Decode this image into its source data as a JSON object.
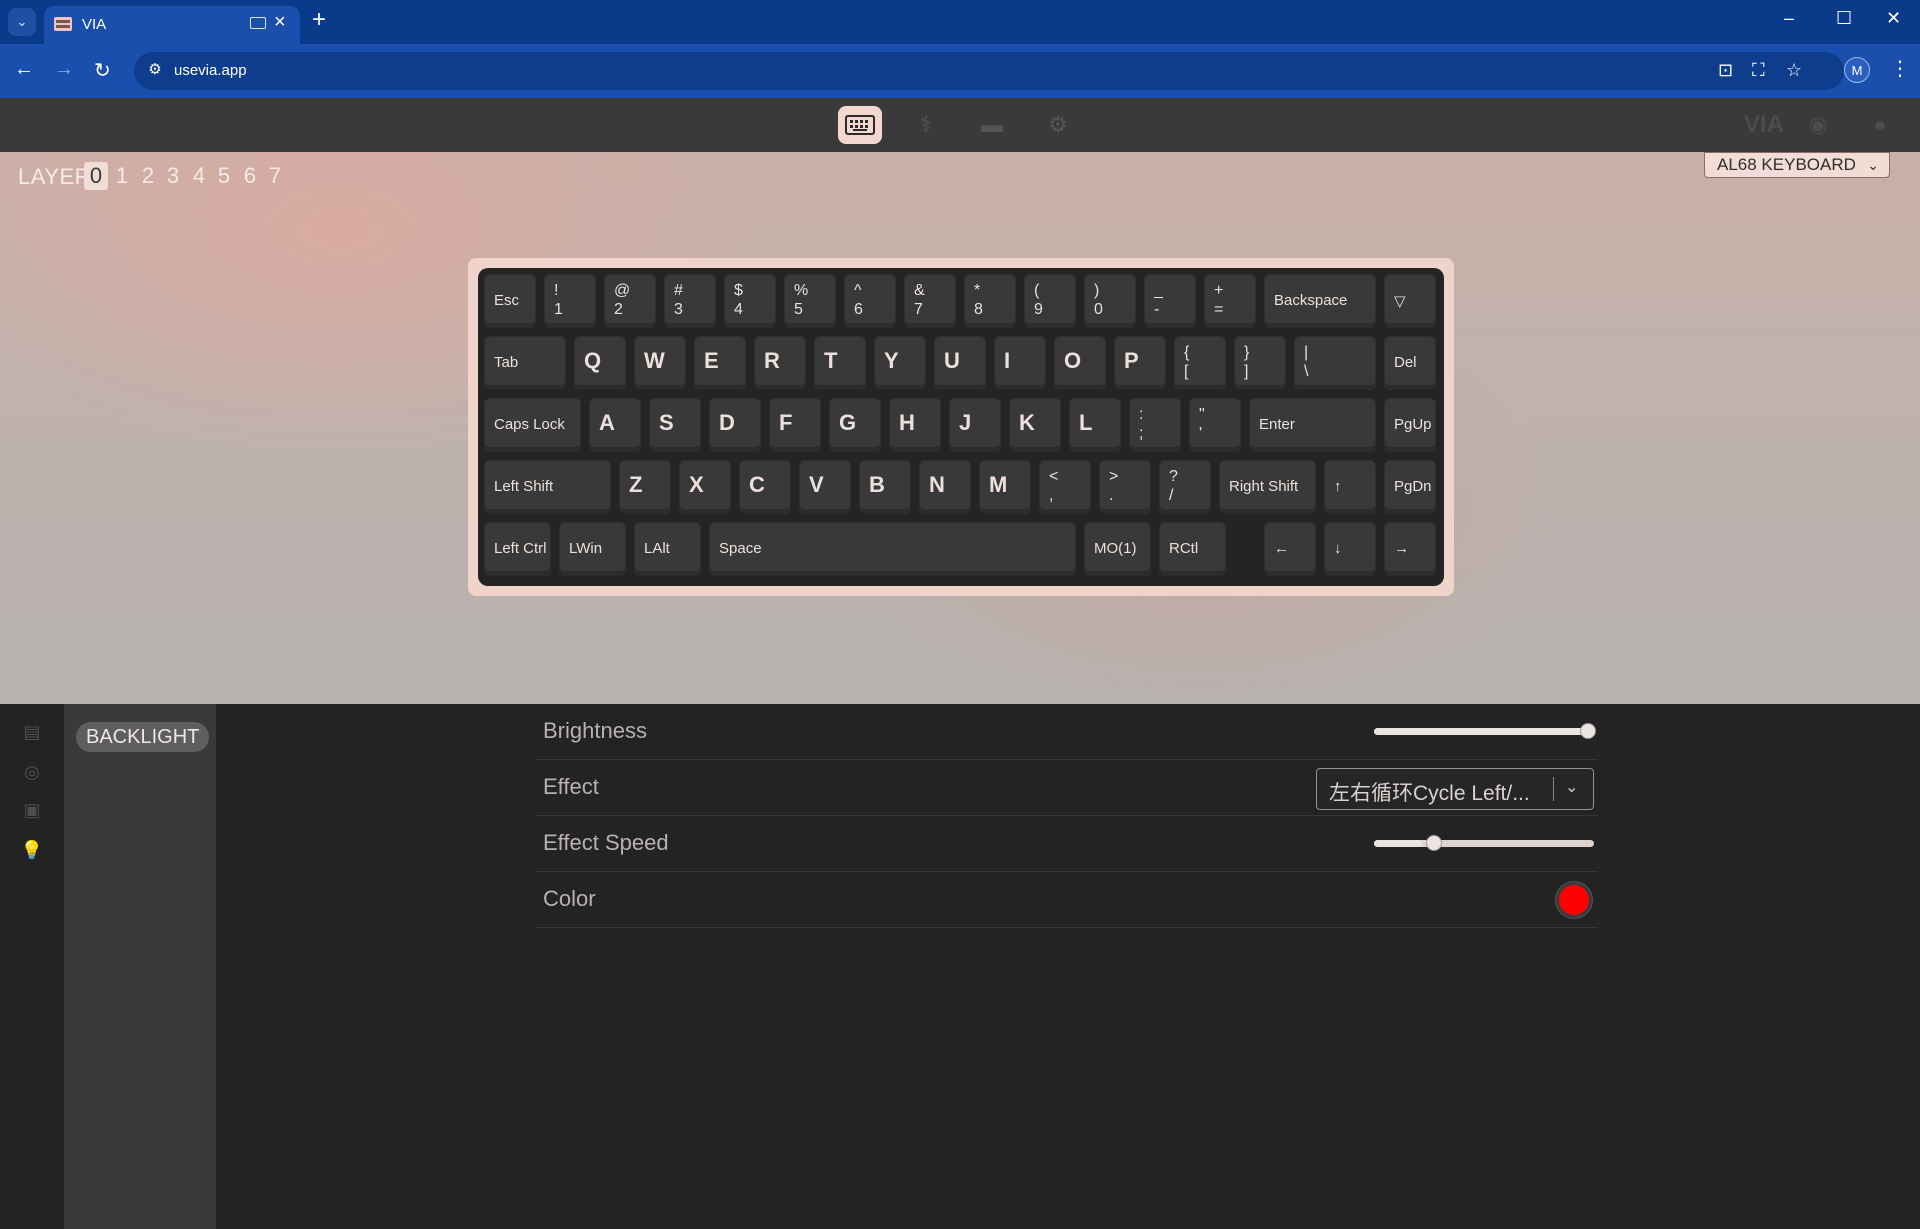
{
  "browser": {
    "tab_title": "VIA",
    "url": "usevia.app",
    "new_tab_label": "+",
    "profile_initial": "M"
  },
  "layers": {
    "label": "LAYER",
    "items": [
      "0",
      "1",
      "2",
      "3",
      "4",
      "5",
      "6",
      "7"
    ],
    "active": "0"
  },
  "keyboard": {
    "name": "AL68 KEYBOARD",
    "keys": {
      "esc": "Esc",
      "n1s": "!",
      "n1": "1",
      "n2s": "@",
      "n2": "2",
      "n3s": "#",
      "n3": "3",
      "n4s": "$",
      "n4": "4",
      "n5s": "%",
      "n5": "5",
      "n6s": "^",
      "n6": "6",
      "n7s": "&",
      "n7": "7",
      "n8s": "*",
      "n8": "8",
      "n9s": "(",
      "n9": "9",
      "n0s": ")",
      "n0": "0",
      "minus_s": "_",
      "minus": "-",
      "eq_s": "+",
      "eq": "=",
      "backspace": "Backspace",
      "tri": "▽",
      "tab": "Tab",
      "q": "Q",
      "w": "W",
      "e": "E",
      "r": "R",
      "t": "T",
      "y": "Y",
      "u": "U",
      "i": "I",
      "o": "O",
      "p": "P",
      "lb_s": "{",
      "lb": "[",
      "rb_s": "}",
      "rb": "]",
      "bsl_s": "|",
      "bsl": "\\",
      "del": "Del",
      "caps": "Caps Lock",
      "a": "A",
      "s": "S",
      "d": "D",
      "f": "F",
      "g": "G",
      "h": "H",
      "j": "J",
      "k": "K",
      "l": "L",
      "sc_s": ":",
      "sc": ";",
      "qt_s": "\"",
      "qt": "'",
      "enter": "Enter",
      "pgup": "PgUp",
      "lshift": "Left Shift",
      "z": "Z",
      "x": "X",
      "c": "C",
      "v": "V",
      "b": "B",
      "n": "N",
      "m": "M",
      "cm_s": "<",
      "cm": ",",
      "pd_s": ">",
      "pd": ".",
      "sl_s": "?",
      "sl": "/",
      "rshift": "Right Shift",
      "up": "↑",
      "pgdn": "PgDn",
      "lctrl": "Left Ctrl",
      "lwin": "LWin",
      "lalt": "LAlt",
      "space": "Space",
      "mo1": "MO(1)",
      "rctl": "RCtl",
      "left": "←",
      "down": "↓",
      "right": "→"
    }
  },
  "sidebar": {
    "active_menu": "BACKLIGHT"
  },
  "backlight": {
    "brightness_label": "Brightness",
    "brightness_value": 1.0,
    "effect_label": "Effect",
    "effect_value": "左右循环Cycle Left/...",
    "effect_speed_label": "Effect Speed",
    "effect_speed_value": 0.22,
    "color_label": "Color",
    "color_value": "#ff0000"
  },
  "colors": {
    "chrome_blue": "#1a4fae",
    "accent_pink": "#f3d8d0",
    "panel_dark": "#232323"
  }
}
